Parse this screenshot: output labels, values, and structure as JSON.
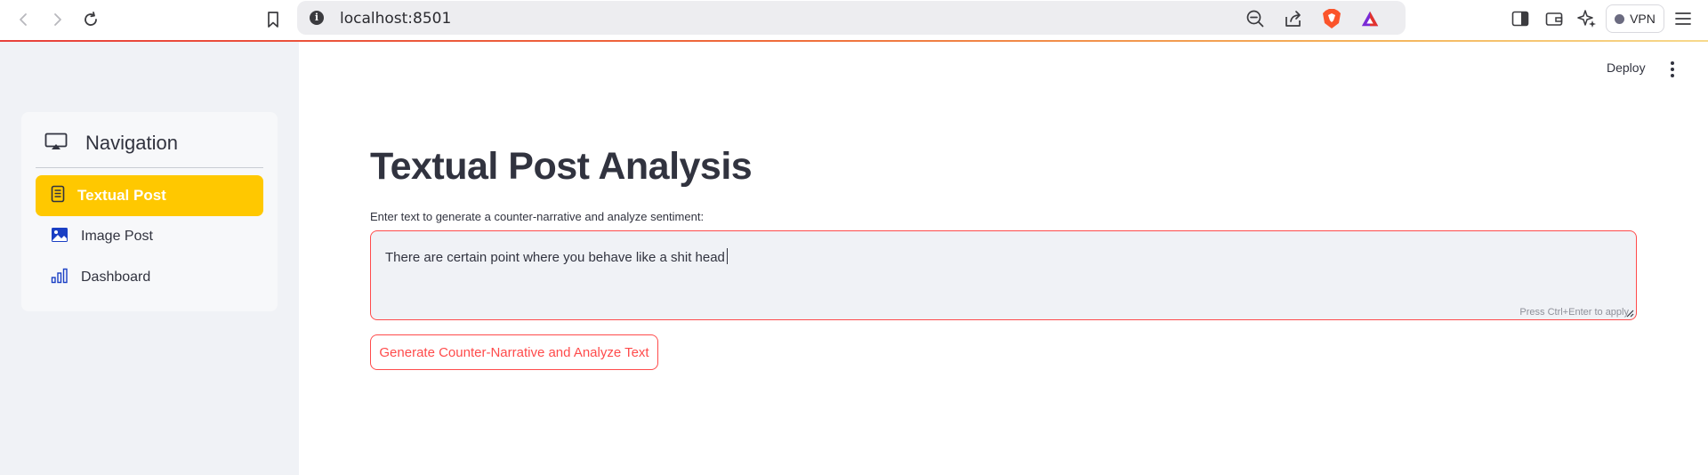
{
  "browser": {
    "url": "localhost:8501",
    "vpn_label": "VPN",
    "icons": [
      "back-icon",
      "forward-icon",
      "reload-icon",
      "bookmark-icon",
      "site-info-icon",
      "zoom-out-icon",
      "share-icon",
      "brave-shields-icon",
      "brave-rewards-icon",
      "sidebar-icon",
      "wallet-icon",
      "leo-ai-icon",
      "menu-icon"
    ]
  },
  "sidebar": {
    "title": "Navigation",
    "items": [
      {
        "label": "Textual Post",
        "icon": "document-icon",
        "active": true
      },
      {
        "label": "Image Post",
        "icon": "image-icon",
        "active": false
      },
      {
        "label": "Dashboard",
        "icon": "bar-chart-icon",
        "active": false
      }
    ],
    "active_color": "#ffc800"
  },
  "header": {
    "deploy_label": "Deploy"
  },
  "main": {
    "title": "Textual Post Analysis",
    "input_label": "Enter text to generate a counter-narrative and analyze sentiment:",
    "input_value": "There are certain point where you behave like a shit head",
    "input_hint": "Press Ctrl+Enter to apply",
    "button_label": "Generate Counter-Narrative and Analyze Text",
    "accent_color": "#ff4b4b"
  }
}
